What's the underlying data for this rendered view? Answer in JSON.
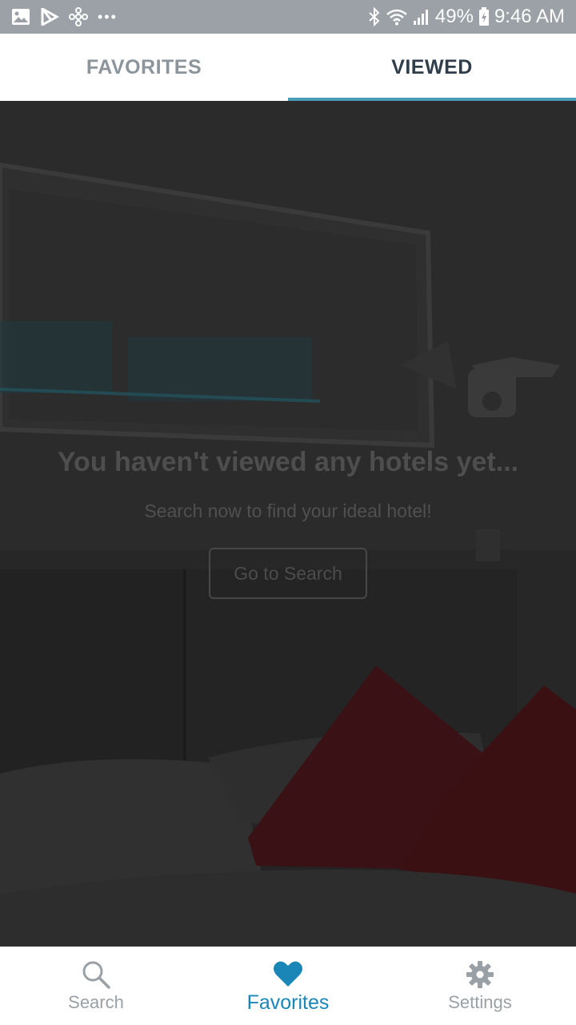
{
  "status_bar": {
    "battery": "49%",
    "time": "9:46 AM",
    "more": "•••",
    "left_icons": [
      "gallery-icon",
      "play-store-icon",
      "fan-icon",
      "more-icon"
    ],
    "right_icons": [
      "bluetooth-icon",
      "wifi-icon",
      "signal-icon",
      "battery-icon"
    ]
  },
  "tabs": [
    {
      "label": "FAVORITES",
      "active": false
    },
    {
      "label": "VIEWED",
      "active": true
    }
  ],
  "empty_state": {
    "title": "You haven't viewed any hotels yet...",
    "subtitle": "Search now to find your ideal hotel!",
    "button_label": "Go to Search"
  },
  "bottom_nav": [
    {
      "label": "Search",
      "icon": "search-icon",
      "active": false
    },
    {
      "label": "Favorites",
      "icon": "heart-icon",
      "active": true
    },
    {
      "label": "Settings",
      "icon": "gear-icon",
      "active": false
    }
  ],
  "colors": {
    "status_bar": "#9ba1a6",
    "tab_indicator": "#4a9db5",
    "active_nav": "#1a86b8",
    "inactive_nav": "#9aa1a6"
  }
}
